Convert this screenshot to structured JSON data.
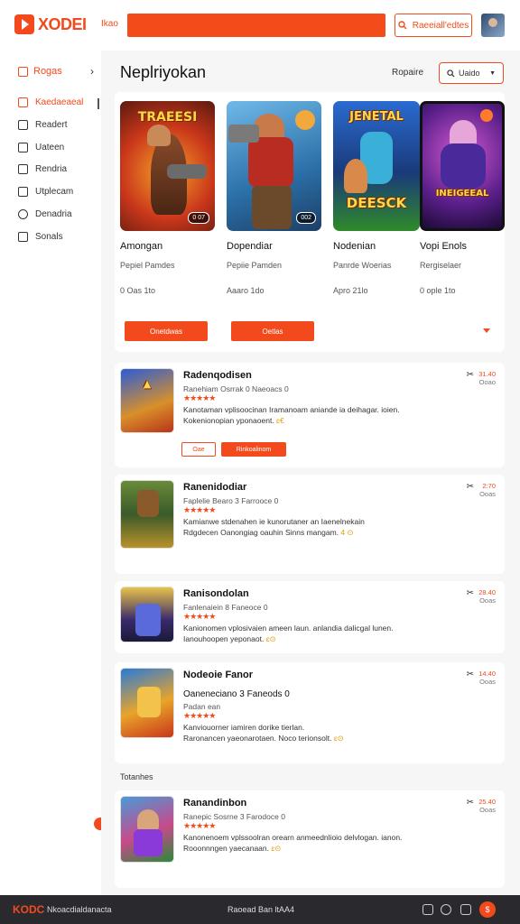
{
  "header": {
    "logo_text": "XODEI",
    "nav_link": "Ikao",
    "search_button_label": "Raeeiall'edtes",
    "colors": {
      "accent": "#f24a1d"
    }
  },
  "sidebar": {
    "top_label": "Rogas",
    "items": [
      {
        "label": "Kaedaeaeal",
        "icon": "gamepad-icon",
        "active": true
      },
      {
        "label": "Readert",
        "icon": "list-icon"
      },
      {
        "label": "Uateen",
        "icon": "news-icon"
      },
      {
        "label": "Rendria",
        "icon": "grid-icon"
      },
      {
        "label": "Utplecam",
        "icon": "book-icon"
      },
      {
        "label": "Denadria",
        "icon": "info-icon"
      },
      {
        "label": "Sonals",
        "icon": "bookmark-icon"
      }
    ]
  },
  "main": {
    "title": "Neplriyokan",
    "sort_label": "Ropaire",
    "sort_value": "Uaido"
  },
  "featured": [
    {
      "art_text": "TRAEESI",
      "title": "Amongan",
      "sub": "Pepiel Pamdes",
      "meta": "0 Oas 1to",
      "badge": "0 07"
    },
    {
      "art_text": "",
      "title": "Dopendiar",
      "sub": "Pepiie Pamden",
      "meta": "Aaaro 1do",
      "badge": "002"
    },
    {
      "art_text": "JENETAL",
      "art_text2": "DEESCK",
      "title": "Nodenian",
      "sub": "Panrde Woerias",
      "meta": "Apro 21lo"
    },
    {
      "art_text": "INEIGEEAL",
      "title": "Vopi Enols",
      "sub": "Rergiselaer",
      "meta": "0 ople 1to"
    }
  ],
  "featured_buttons": [
    "Onetdwas",
    "Oetlas"
  ],
  "list": [
    {
      "title": "Radenqodisen",
      "sub": "Ranehiam Osrrak 0 Naeoacs 0",
      "stars": "★★★★★",
      "desc1": "Kanotaman vplisoocinan Iramanoam aniande ia deihagar. ioien.",
      "desc2": "Kokenionopian yponaoent.",
      "desc2_hl": "ɛ€",
      "price1": "31.40",
      "price2": "Ooao",
      "btn_outline": "Oae",
      "btn_solid": "Rinkoalinom",
      "art": "A"
    },
    {
      "title": "Ranenidodiar",
      "sub": "Faplelie Bearo 3 Farrooce 0",
      "stars": "★★★★★",
      "desc1": "Kamianwe stdenahen ie kunorutaner an Iaenelnekain",
      "desc2": "Rdgdecen Oanongiag oauhin Sinns mangam.",
      "desc2_hl": "4 ⊙",
      "price1": "2:70",
      "price2": "Ooas",
      "art": "B"
    },
    {
      "title": "Ranisondolan",
      "sub": "Fanlenaiein 8 Faneoce 0",
      "stars": "★★★★★",
      "desc1": "Kanionomen vplosivaien ameen laun. anlandia dalicgal lunen.",
      "desc2": "Ianouhoopen yeponaot.",
      "desc2_hl": "ɛ⊙",
      "price1": "28.40",
      "price2": "Ooas",
      "art": "C"
    },
    {
      "title": "Nodeoie Fanor",
      "sub2": "Oaneneciano 3 Faneods 0",
      "sub": "Padan ean",
      "stars": "★★★★★",
      "desc1": "Kanviouorner iamiren dorike tierlan.",
      "desc2": "Raronancen yaeonarotaen. Noco terionsolt.",
      "desc2_hl": "ɛ⊙",
      "price1": "14.40",
      "price2": "Ooas",
      "art": "D"
    },
    {
      "title": "Ranandinbon",
      "sub": "Ranepic Sosrne 3 Farodoce 0",
      "stars": "★★★★★",
      "desc1": "Kanonenoem vplssoolran orearn anmeednlioio delvlogan. ianon.",
      "desc2": "Rooonnngen yaecanaan.",
      "desc2_hl": "ɛ⊙",
      "price1": "25.40",
      "price2": "Ooas",
      "art": "E"
    }
  ],
  "section_label": "Totanhes",
  "footer": {
    "logo": "KODC",
    "text1": "Nkoacdialdanacta",
    "text2": "Raoead Ban ltAA4"
  }
}
